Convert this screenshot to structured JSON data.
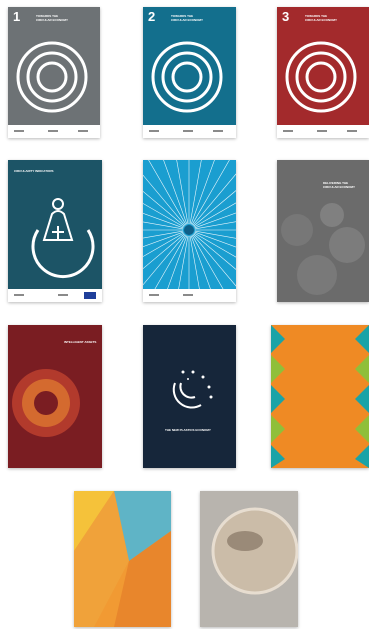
{
  "covers": {
    "c1": {
      "number": "1",
      "title_l1": "TOWARDS THE",
      "title_l2": "CIRCULAR ECONOMY",
      "bg": "#6d7275"
    },
    "c2": {
      "number": "2",
      "title_l1": "TOWARDS THE",
      "title_l2": "CIRCULAR ECONOMY",
      "bg": "#136f8d"
    },
    "c3": {
      "number": "3",
      "title_l1": "TOWARDS THE",
      "title_l2": "CIRCULAR ECONOMY",
      "bg": "#a32a2c"
    },
    "c4": {
      "title_l1": "CIRCULARITY INDICATORS",
      "bg": "#1c5466"
    },
    "c5": {
      "bg": "#1a9ed0"
    },
    "c6": {
      "title_l1": "DELIVERING THE",
      "title_l2": "CIRCULAR ECONOMY",
      "bg": "#6b6b6b"
    },
    "c7": {
      "title_l1": "INTELLIGENT ASSETS",
      "bg": "#7a1d22"
    },
    "c8": {
      "title_l1": "THE NEW PLASTICS ECONOMY",
      "bg": "#16263a"
    },
    "c9": {
      "bg": "#ef8a24",
      "accent": "#1aa3a7"
    },
    "c10": {
      "bg": "#f19a33"
    },
    "c11": {
      "bg": "#b8b4ae"
    }
  }
}
